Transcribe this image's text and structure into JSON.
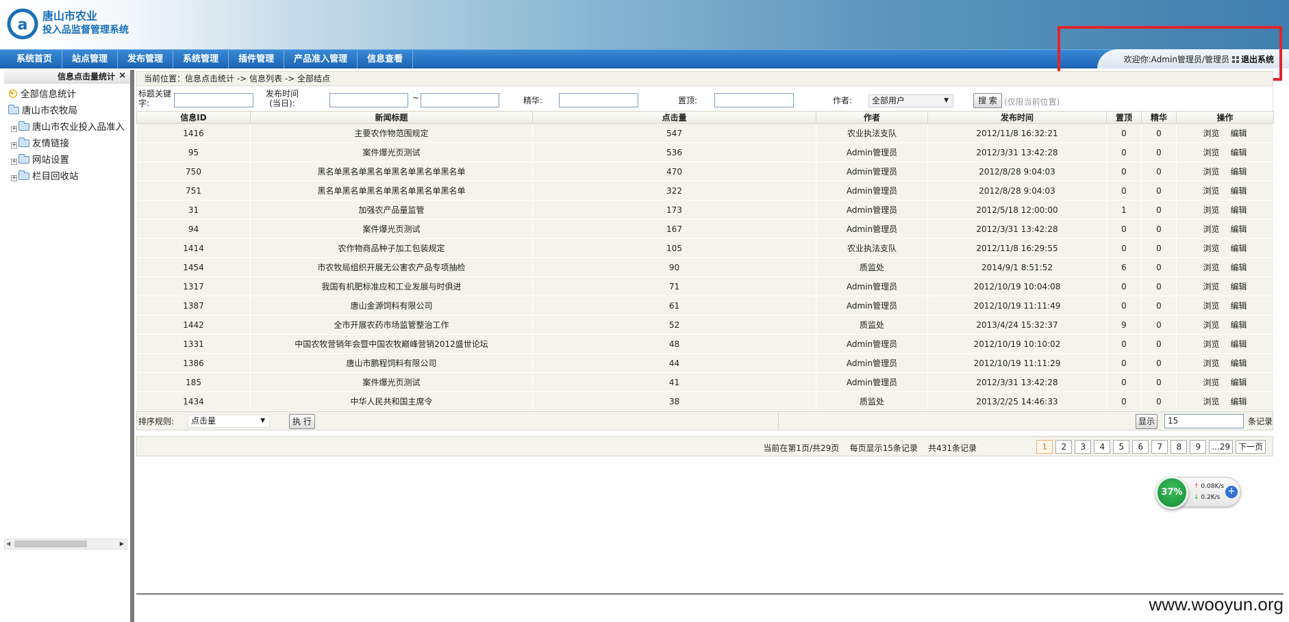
{
  "header": {
    "logo_line1": "唐山市农业",
    "logo_line2": "投入品监督管理系统"
  },
  "nav": {
    "items": [
      "系统首页",
      "站点管理",
      "发布管理",
      "系统管理",
      "插件管理",
      "产品准入管理",
      "信息查看"
    ]
  },
  "user": {
    "welcome": "欢迎你:Admin管理员/管理员",
    "logout": "退出系统"
  },
  "left_panel": {
    "title": "信息点击量统计",
    "close": "×",
    "tree": [
      {
        "label": "全部信息统计",
        "expander": "",
        "icon": "star-icon"
      },
      {
        "label": "唐山市农牧局",
        "expander": "",
        "icon": "folder-open-icon"
      },
      {
        "label": "唐山市农业投入品准入",
        "expander": "+",
        "icon": "folder-icon"
      },
      {
        "label": "友情链接",
        "expander": "+",
        "icon": "folder-icon"
      },
      {
        "label": "网站设置",
        "expander": "+",
        "icon": "folder-icon"
      },
      {
        "label": "栏目回收站",
        "expander": "+",
        "icon": "folder-icon"
      }
    ]
  },
  "breadcrumb": "当前位置：信息点击统计 -> 信息列表 -> 全部结点",
  "filters": {
    "keyword_label_1": "标题关键",
    "keyword_label_2": "字:",
    "time_label_1": "发布时间",
    "time_label_2": "(当日):",
    "tilde": "~",
    "featured_label": "精华:",
    "top_label": "置顶:",
    "author_label": "作者:",
    "author_value": "全部用户",
    "search_button": "搜 索",
    "search_hint": "(仅限当前位置)"
  },
  "table": {
    "headers": [
      "信息ID",
      "新闻标题",
      "点击量",
      "作者",
      "发布时间",
      "置顶",
      "精华",
      "操作"
    ],
    "op_view": "浏览",
    "op_edit": "编辑",
    "rows": [
      [
        "1416",
        "主要农作物范围规定",
        "547",
        "农业执法支队",
        "2012/11/8 16:32:21",
        "0",
        "0"
      ],
      [
        "95",
        "案件爆光页测试",
        "536",
        "Admin管理员",
        "2012/3/31 13:42:28",
        "0",
        "0"
      ],
      [
        "750",
        "黑名单黑名单黑名单黑名单黑名单黑名单",
        "470",
        "Admin管理员",
        "2012/8/28 9:04:03",
        "0",
        "0"
      ],
      [
        "751",
        "黑名单黑名单黑名单黑名单黑名单黑名单",
        "322",
        "Admin管理员",
        "2012/8/28 9:04:03",
        "0",
        "0"
      ],
      [
        "31",
        "加强农产品量监管",
        "173",
        "Admin管理员",
        "2012/5/18 12:00:00",
        "1",
        "0"
      ],
      [
        "94",
        "案件爆光页测试",
        "167",
        "Admin管理员",
        "2012/3/31 13:42:28",
        "0",
        "0"
      ],
      [
        "1414",
        "农作物商品种子加工包装规定",
        "105",
        "农业执法支队",
        "2012/11/8 16:29:55",
        "0",
        "0"
      ],
      [
        "1454",
        "市农牧局组织开展无公害农产品专项抽检",
        "90",
        "质监处",
        "2014/9/1 8:51:52",
        "6",
        "0"
      ],
      [
        "1317",
        "我国有机肥标准应和工业发展与时俱进",
        "71",
        "Admin管理员",
        "2012/10/19 10:04:08",
        "0",
        "0"
      ],
      [
        "1387",
        "唐山金源饲料有限公司",
        "61",
        "Admin管理员",
        "2012/10/19 11:11:49",
        "0",
        "0"
      ],
      [
        "1442",
        "全市开展农药市场监管整治工作",
        "52",
        "质监处",
        "2013/4/24 15:32:37",
        "9",
        "0"
      ],
      [
        "1331",
        "中国农牧营销年会暨中国农牧巅峰营销2012盛世论坛",
        "48",
        "Admin管理员",
        "2012/10/19 10:10:02",
        "0",
        "0"
      ],
      [
        "1386",
        "唐山市鹏程饲料有限公司",
        "44",
        "Admin管理员",
        "2012/10/19 11:11:29",
        "0",
        "0"
      ],
      [
        "185",
        "案件爆光页测试",
        "41",
        "Admin管理员",
        "2012/3/31 13:42:28",
        "0",
        "0"
      ],
      [
        "1434",
        "中华人民共和国主席令",
        "38",
        "质监处",
        "2013/2/25 14:46:33",
        "0",
        "0"
      ]
    ]
  },
  "sort_bar": {
    "label": "排序规则:",
    "value": "点击量",
    "execute": "执 行",
    "show_button": "显示",
    "show_count": "15",
    "records_suffix": "条记录"
  },
  "pagination": {
    "info": "当前在第1页/共29页    每页显示15条记录    共431条记录",
    "pages": [
      "1",
      "2",
      "3",
      "4",
      "5",
      "6",
      "7",
      "8",
      "9",
      "...29",
      "下一页"
    ]
  },
  "net_widget": {
    "percent": "37%",
    "up": "0.08K/s",
    "down": "0.2K/s"
  },
  "watermark": "www.wooyun.org"
}
